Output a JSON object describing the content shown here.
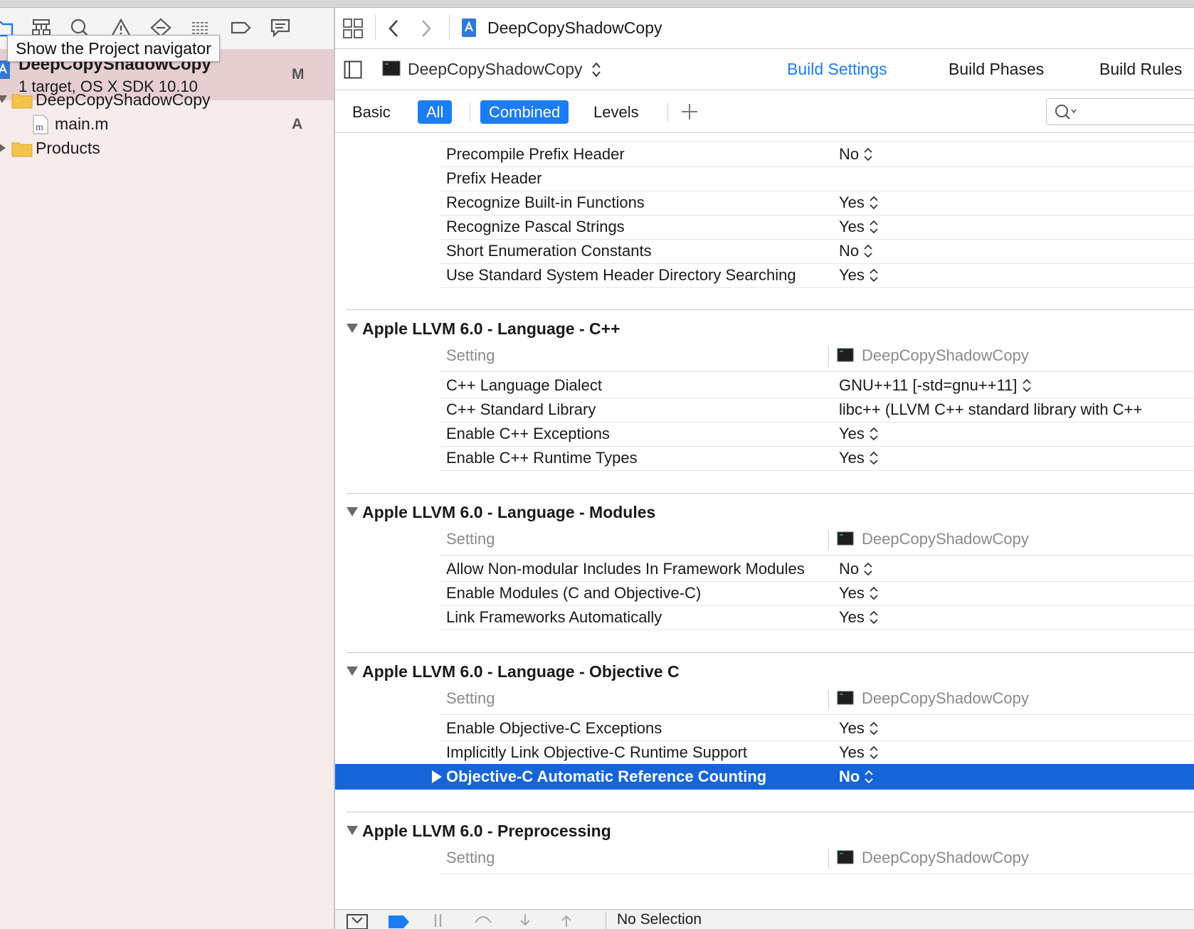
{
  "navigator": {
    "tooltip": "Show the Project navigator",
    "project": {
      "name": "DeepCopyShadowCopy",
      "subtitle": "1 target, OS X SDK 10.10",
      "badge": "M"
    },
    "tree": [
      {
        "label": "DeepCopyShadowCopy",
        "kind": "folder",
        "badge": ""
      },
      {
        "label": "main.m",
        "kind": "file",
        "badge": "A"
      },
      {
        "label": "Products",
        "kind": "folder",
        "badge": ""
      }
    ],
    "toolbar_icons": [
      "folder-icon",
      "hierarchy-icon",
      "search-icon",
      "warning-icon",
      "breakpoint-diamond-icon",
      "list-icon",
      "tag-icon",
      "comment-icon"
    ]
  },
  "jumpbar": {
    "file_title": "DeepCopyShadowCopy"
  },
  "editorbar": {
    "target": "DeepCopyShadowCopy",
    "tabs": [
      "Build Settings",
      "Build Phases",
      "Build Rules"
    ],
    "active_tab": "Build Settings"
  },
  "filterbar": {
    "basic": "Basic",
    "all": "All",
    "combined": "Combined",
    "levels": "Levels",
    "plus": "+"
  },
  "settings": {
    "top_rows": [
      {
        "name": "Precompile Prefix Header",
        "value": "No"
      },
      {
        "name": "Prefix Header",
        "value": ""
      },
      {
        "name": "Recognize Built-in Functions",
        "value": "Yes"
      },
      {
        "name": "Recognize Pascal Strings",
        "value": "Yes"
      },
      {
        "name": "Short Enumeration Constants",
        "value": "No"
      },
      {
        "name": "Use Standard System Header Directory Searching",
        "value": "Yes"
      }
    ],
    "sections": [
      {
        "title": "Apple LLVM 6.0 - Language - C++",
        "setting_col": "Setting",
        "target_col": "DeepCopyShadowCopy",
        "rows": [
          {
            "name": "C++ Language Dialect",
            "value": "GNU++11 [-std=gnu++11]"
          },
          {
            "name": "C++ Standard Library",
            "value": "libc++ (LLVM C++ standard library with C++"
          },
          {
            "name": "Enable C++ Exceptions",
            "value": "Yes"
          },
          {
            "name": "Enable C++ Runtime Types",
            "value": "Yes"
          }
        ]
      },
      {
        "title": "Apple LLVM 6.0 - Language - Modules",
        "setting_col": "Setting",
        "target_col": "DeepCopyShadowCopy",
        "rows": [
          {
            "name": "Allow Non-modular Includes In Framework Modules",
            "value": "No"
          },
          {
            "name": "Enable Modules (C and Objective-C)",
            "value": "Yes"
          },
          {
            "name": "Link Frameworks Automatically",
            "value": "Yes"
          }
        ]
      },
      {
        "title": "Apple LLVM 6.0 - Language - Objective C",
        "setting_col": "Setting",
        "target_col": "DeepCopyShadowCopy",
        "rows": [
          {
            "name": "Enable Objective-C Exceptions",
            "value": "Yes"
          },
          {
            "name": "Implicitly Link Objective-C Runtime Support",
            "value": "Yes"
          },
          {
            "name": "Objective-C Automatic Reference Counting",
            "value": "No"
          }
        ]
      },
      {
        "title": "Apple LLVM 6.0 - Preprocessing",
        "setting_col": "Setting",
        "target_col": "DeepCopyShadowCopy",
        "rows": []
      }
    ]
  },
  "bottombar": {
    "status": "No Selection"
  },
  "colors": {
    "accent": "#1c7cf2",
    "selection": "#1565d8",
    "navigator_bg": "#f7ecec",
    "navigator_selected": "#e6cfd1",
    "folder": "#f3c44d"
  }
}
